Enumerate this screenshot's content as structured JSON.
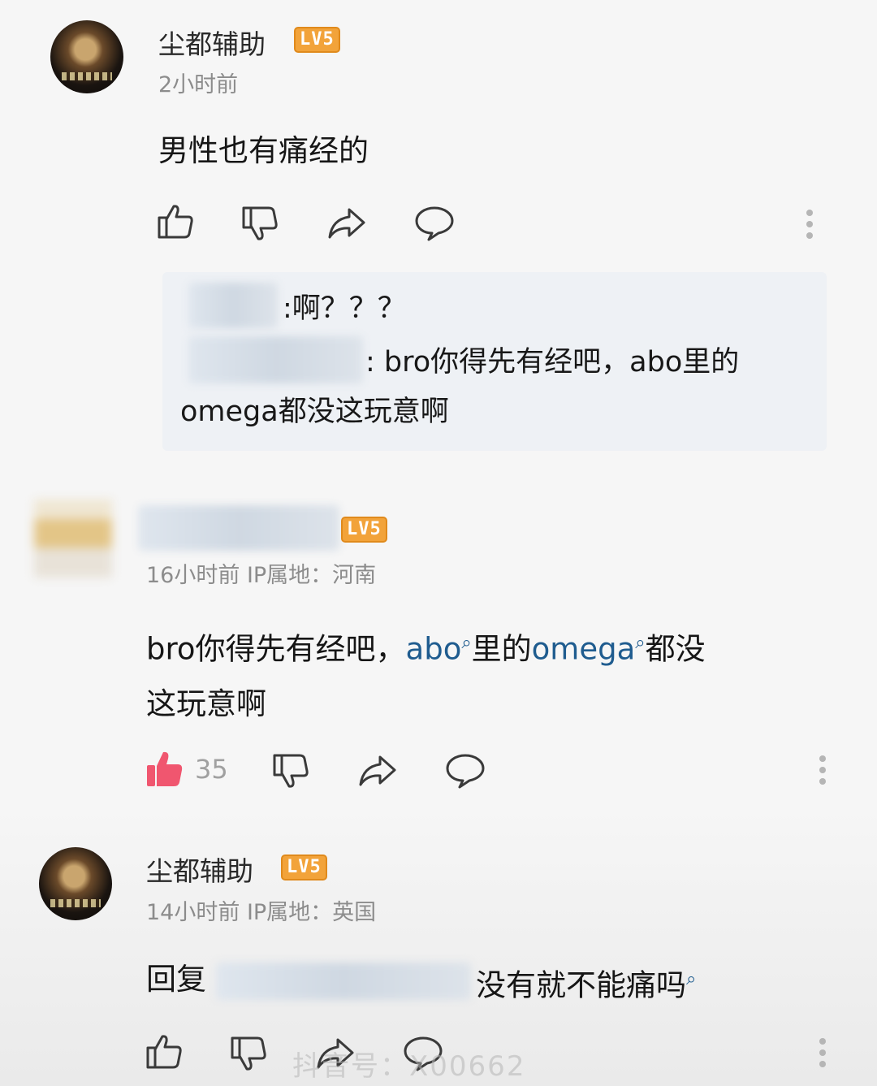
{
  "comments": [
    {
      "author": "尘都辅助",
      "level": "LV5",
      "time": "2小时前",
      "text": "男性也有痛经的"
    },
    {
      "level": "LV5",
      "time": "16小时前 IP属地：河南",
      "text_parts": [
        "bro你得先有经吧，",
        "abo",
        "里的",
        "omega",
        "都没",
        "这玩意啊"
      ],
      "likes": "35"
    },
    {
      "author": "尘都辅助",
      "level": "LV5",
      "time": "14小时前 IP属地：英国",
      "reply_prefix": "回复",
      "text": "没有就不能痛吗"
    }
  ],
  "replies": [
    {
      "text": ":啊？？？"
    },
    {
      "text_line1": ": bro你得先有经吧，abo里的",
      "text_line2": "omega都没这玩意啊"
    }
  ],
  "watermark": "抖音号：X00662",
  "icons": [
    "thumb-up-icon",
    "thumb-down-icon",
    "share-icon",
    "comment-icon",
    "more-icon",
    "search-icon"
  ],
  "colors": {
    "link": "#1f5c8f",
    "liked": "#f0566f",
    "level_badge": "#f2a33a"
  }
}
